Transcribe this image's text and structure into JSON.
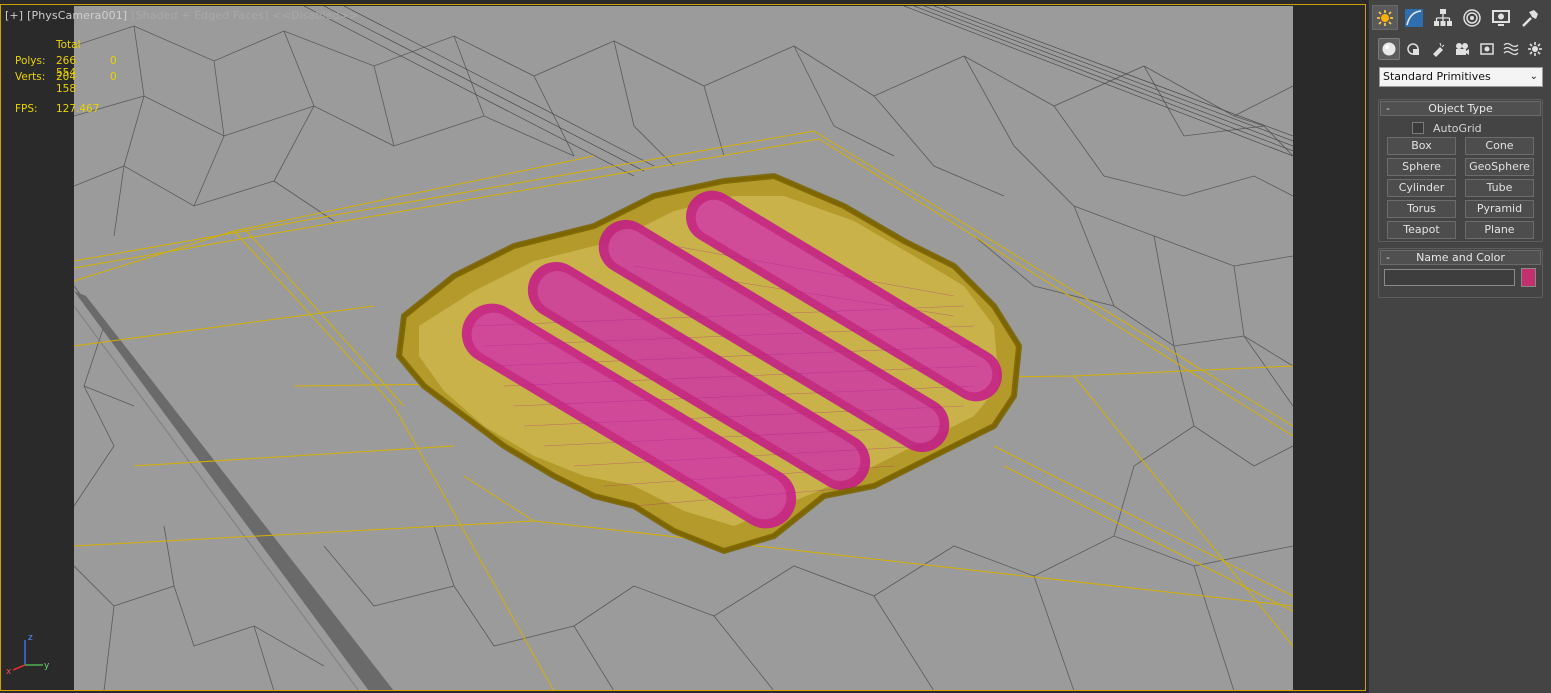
{
  "viewport": {
    "label_parts": [
      "[+]",
      "[PhysCamera001]",
      "[Shaded + Edged Faces]",
      "<<Disabled>>"
    ],
    "stats": {
      "header": "Total",
      "polys_label": "Polys:",
      "polys_value": "266 554",
      "polys_selected": "0",
      "verts_label": "Verts:",
      "verts_value": "204 158",
      "verts_selected": "0",
      "fps_label": "FPS:",
      "fps_value": "127.467"
    },
    "axis": {
      "x": "x",
      "y": "y",
      "z": "z"
    },
    "colors": {
      "background": "#9b9b9b",
      "mesh_lines": "#585858",
      "selection_wire": "#d4b100",
      "object_wire": "#c8aa00",
      "sausage_wire": "#c0208a"
    }
  },
  "panel": {
    "tabs": [
      "create-icon",
      "modify-icon",
      "hierarchy-icon",
      "motion-icon",
      "display-icon",
      "utilities-icon"
    ],
    "subcategories": [
      "geometry-icon",
      "shapes-icon",
      "lights-icon",
      "cameras-icon",
      "helpers-icon",
      "spacewarps-icon",
      "systems-icon"
    ],
    "category_dropdown": "Standard Primitives",
    "object_type": {
      "title": "Object Type",
      "minus": "-",
      "autogrid_label": "AutoGrid",
      "autogrid_checked": false,
      "buttons": [
        "Box",
        "Cone",
        "Sphere",
        "GeoSphere",
        "Cylinder",
        "Tube",
        "Torus",
        "Pyramid",
        "Teapot",
        "Plane"
      ]
    },
    "name_and_color": {
      "title": "Name and Color",
      "minus": "-",
      "name_value": "",
      "color": "#c2306e"
    }
  }
}
